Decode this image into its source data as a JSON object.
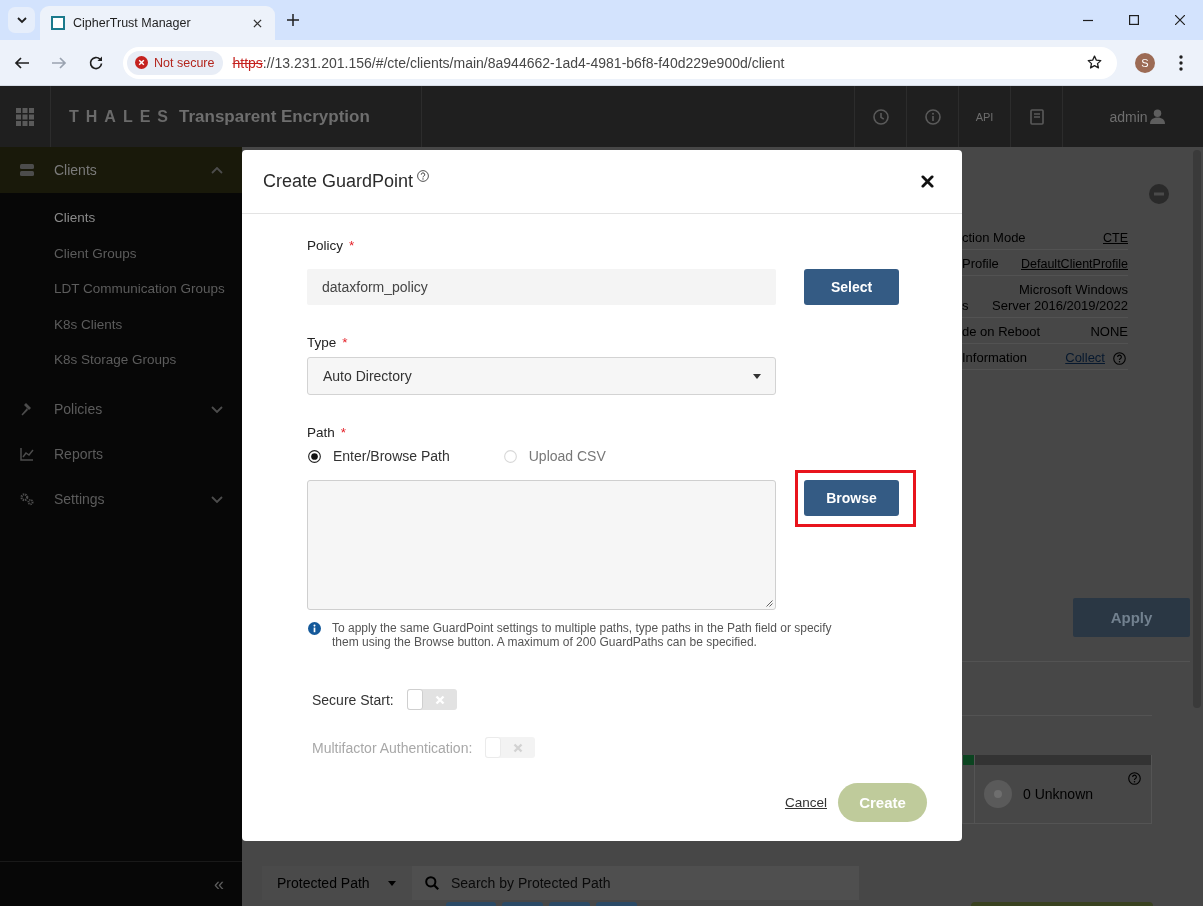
{
  "browser": {
    "tab_title": "CipherTrust Manager",
    "forward_disabled": true,
    "security_label": "Not secure",
    "url_scheme": "https",
    "url_rest": "://13.231.201.156/#/cte/clients/main/8a944662-1ad4-4981-b6f8-f40d229e900d/client",
    "profile_initial": "S"
  },
  "app_header": {
    "brand": "THALES",
    "product": "Transparent Encryption",
    "api_label": "API",
    "user_name": "admin"
  },
  "sidebar": {
    "sections": [
      {
        "kind": "group",
        "label": "Clients",
        "selected": true,
        "expanded": true,
        "children": [
          {
            "label": "Clients",
            "selected": true
          },
          {
            "label": "Client Groups",
            "selected": false
          },
          {
            "label": "LDT Communication Groups",
            "selected": false
          },
          {
            "label": "K8s Clients",
            "selected": false
          },
          {
            "label": "K8s Storage Groups",
            "selected": false
          }
        ]
      },
      {
        "kind": "group",
        "label": "Policies",
        "selected": false,
        "expanded": false
      },
      {
        "kind": "link",
        "label": "Reports",
        "selected": false
      },
      {
        "kind": "group",
        "label": "Settings",
        "selected": false,
        "expanded": false
      }
    ],
    "collapse_label": "«"
  },
  "client_details": {
    "rows": [
      {
        "kind": "link",
        "label": "ction Mode",
        "value": "CTE"
      },
      {
        "kind": "link",
        "label": "Profile",
        "value": "DefaultClientProfile"
      },
      {
        "kind": "text",
        "label": "s",
        "value": "Microsoft Windows Server 2016/2019/2022"
      },
      {
        "kind": "text",
        "label": "de on Reboot",
        "value": "NONE"
      },
      {
        "kind": "help_link",
        "label": "Information",
        "value": "Collect"
      }
    ],
    "apply_label": "Apply",
    "status_cards": [
      {
        "color": "#0b4420"
      },
      {
        "color": "#333333",
        "label": "0 Unknown"
      }
    ]
  },
  "protected_paths": {
    "filter_label": "Protected Path",
    "placeholder": "Search by Protected Path"
  },
  "dialog": {
    "title": "Create GuardPoint",
    "fields": [
      {
        "kind": "text",
        "label": "Policy",
        "required_mark": "*",
        "value": "dataxform_policy",
        "button": {
          "label": "Select",
          "highlighted": false
        }
      },
      {
        "kind": "select",
        "label": "Type",
        "required_mark": "*",
        "value": "Auto Directory"
      },
      {
        "kind": "path",
        "label": "Path",
        "required_mark": "*",
        "options": [
          {
            "label": "Enter/Browse Path",
            "selected": true
          },
          {
            "label": "Upload CSV",
            "selected": false
          }
        ],
        "button": {
          "label": "Browse",
          "highlighted": true
        }
      }
    ],
    "note": "To apply the same GuardPoint settings to multiple paths, type paths in the Path field or specify them using the Browse button. A maximum of 200 GuardPaths can be specified.",
    "toggles": [
      {
        "label": "Secure Start:",
        "on": false,
        "disabled": false
      },
      {
        "label": "Multifactor Authentication:",
        "on": false,
        "disabled": true
      }
    ],
    "cancel_label": "Cancel",
    "submit": {
      "label": "Create",
      "disabled": true
    }
  }
}
